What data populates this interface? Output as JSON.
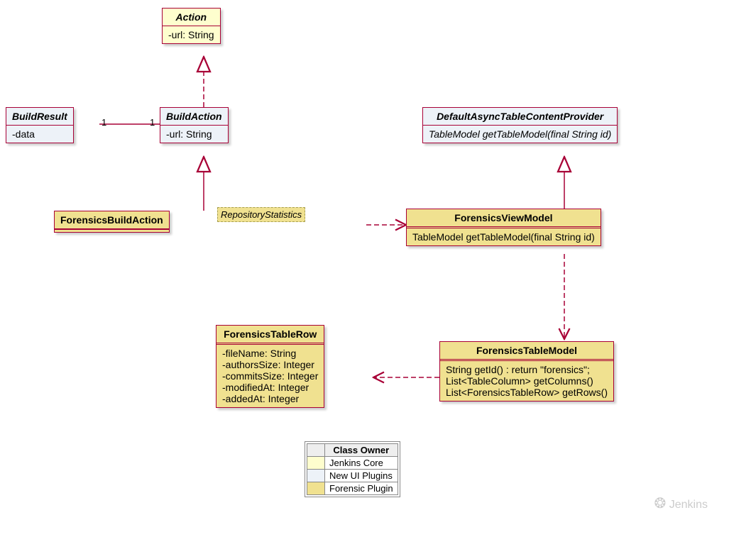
{
  "classes": {
    "action": {
      "name": "Action",
      "attrs": [
        "-url: String"
      ]
    },
    "buildResult": {
      "name": "BuildResult",
      "attrs": [
        "-data"
      ]
    },
    "buildAction": {
      "name": "BuildAction",
      "attrs": [
        "-url: String"
      ]
    },
    "forensicsBuildAction": {
      "name": "ForensicsBuildAction",
      "tag": "RepositoryStatistics"
    },
    "provider": {
      "name": "DefaultAsyncTableContentProvider",
      "methods": [
        "TableModel getTableModel(final String id)"
      ]
    },
    "viewModel": {
      "name": "ForensicsViewModel",
      "methods": [
        "TableModel getTableModel(final String id)"
      ]
    },
    "tableModel": {
      "name": "ForensicsTableModel",
      "methods": [
        "String getId() : return \"forensics\";",
        "List<TableColumn> getColumns()",
        "List<ForensicsTableRow> getRows()"
      ]
    },
    "tableRow": {
      "name": "ForensicsTableRow",
      "attrs": [
        "-fileName: String",
        "-authorsSize: Integer",
        "-commitsSize: Integer",
        "-modifiedAt: Integer",
        "-addedAt: Integer"
      ]
    }
  },
  "assoc": {
    "left": "1",
    "right": "1"
  },
  "legend": {
    "title": "Class Owner",
    "rows": [
      {
        "label": "Jenkins Core",
        "color": "#fefece"
      },
      {
        "label": "New UI Plugins",
        "color": "#edf2f8"
      },
      {
        "label": "Forensic Plugin",
        "color": "#f0e190"
      }
    ]
  },
  "watermark": "Jenkins"
}
